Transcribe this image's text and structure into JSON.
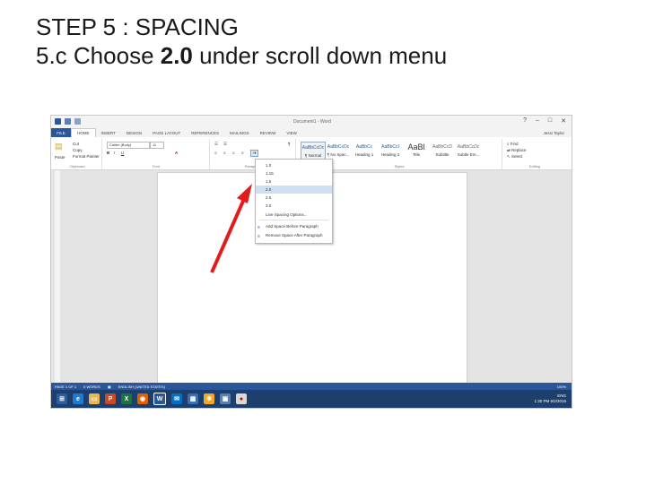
{
  "slide": {
    "title_line1": "STEP 5 : SPACING",
    "title_line2_prefix": "5.c Choose ",
    "title_line2_bold": "2.0",
    "title_line2_suffix": " under scroll down menu"
  },
  "window": {
    "title": "Document1 - Word",
    "user": "Jessi Taylor"
  },
  "ribbon_tabs": {
    "file": "FILE",
    "items": [
      "HOME",
      "INSERT",
      "DESIGN",
      "PAGE LAYOUT",
      "REFERENCES",
      "MAILINGS",
      "REVIEW",
      "VIEW"
    ]
  },
  "ribbon": {
    "clipboard": {
      "paste": "Paste",
      "cut": "Cut",
      "copy": "Copy",
      "format_painter": "Format Painter",
      "label": "Clipboard"
    },
    "font": {
      "name": "Calibri (Body)",
      "size": "11",
      "label": "Font"
    },
    "paragraph": {
      "label": "Paragraph"
    },
    "styles": {
      "label": "Styles",
      "tiles": [
        {
          "preview": "AaBbCcDc",
          "name": "¶ Normal"
        },
        {
          "preview": "AaBbCcDc",
          "name": "¶ No Spac..."
        },
        {
          "preview": "AaBbCc",
          "name": "Heading 1"
        },
        {
          "preview": "AaBbCcI",
          "name": "Heading 2"
        },
        {
          "preview": "AaBl",
          "name": "Title"
        },
        {
          "preview": "AaBbCcD",
          "name": "Subtitle"
        },
        {
          "preview": "AaBbCcDc",
          "name": "Subtle Em..."
        }
      ]
    },
    "editing": {
      "find": "Find",
      "replace": "Replace",
      "select": "Select",
      "label": "Editing"
    }
  },
  "spacing_menu": {
    "options": [
      "1.0",
      "1.15",
      "1.5",
      "2.0",
      "2.5",
      "3.0"
    ],
    "selected": "2.0",
    "line_spacing_options": "Line Spacing Options...",
    "add_space_before": "Add Space Before Paragraph",
    "remove_space_after": "Remove Space After Paragraph"
  },
  "status_bar": {
    "page": "PAGE 1 OF 1",
    "words": "0 WORDS",
    "language": "ENGLISH (UNITED STATES)",
    "zoom": "100%"
  },
  "taskbar": {
    "time": "1:30 PM",
    "date": "6/2/2016",
    "lang": "ENG"
  },
  "colors": {
    "word_blue": "#2b579a",
    "taskbar": "#1d3f6e",
    "arrow": "#e31b1b",
    "menu_highlight": "#cde0f2"
  }
}
